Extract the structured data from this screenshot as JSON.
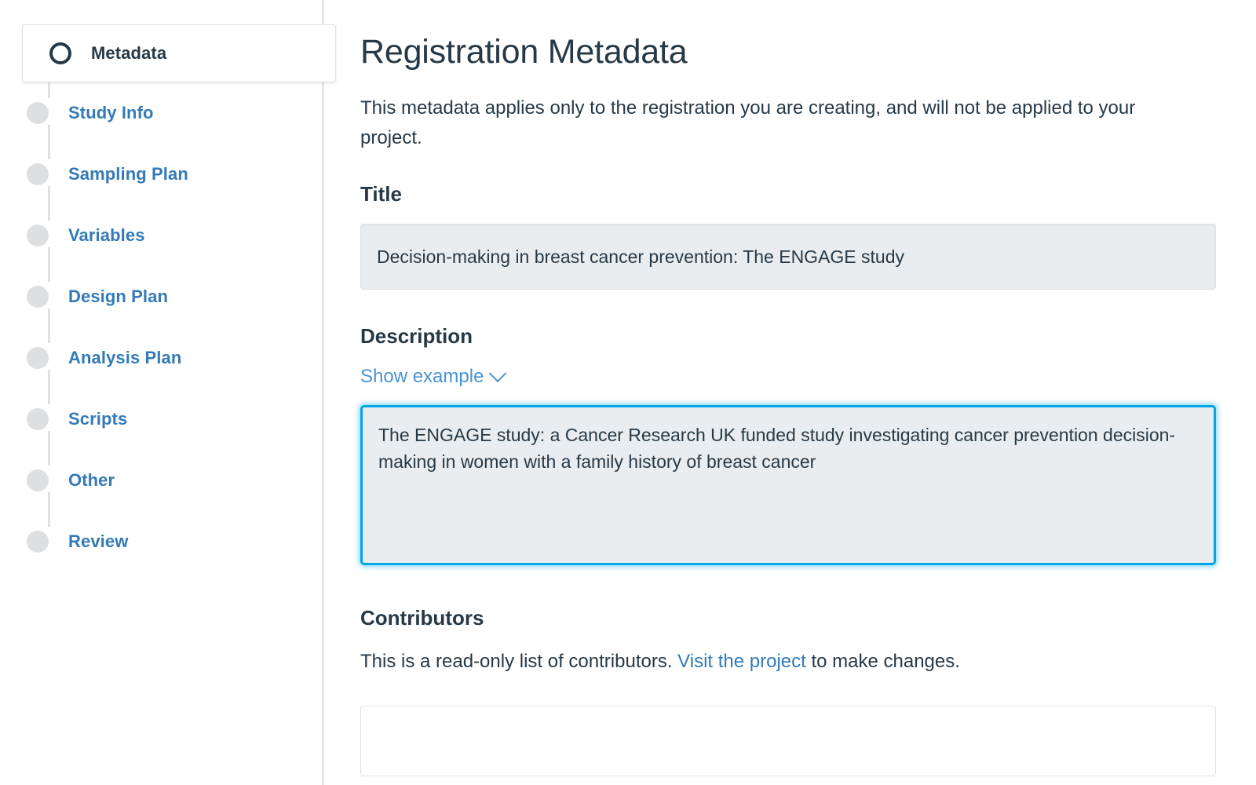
{
  "sidebar": {
    "steps": [
      {
        "label": "Metadata",
        "state": "active",
        "marker": "ring-icon"
      },
      {
        "label": "Study Info",
        "state": "pending",
        "marker": "dot-icon"
      },
      {
        "label": "Sampling Plan",
        "state": "pending",
        "marker": "dot-icon"
      },
      {
        "label": "Variables",
        "state": "pending",
        "marker": "dot-icon"
      },
      {
        "label": "Design Plan",
        "state": "pending",
        "marker": "dot-icon"
      },
      {
        "label": "Analysis Plan",
        "state": "pending",
        "marker": "dot-icon"
      },
      {
        "label": "Scripts",
        "state": "pending",
        "marker": "dot-icon"
      },
      {
        "label": "Other",
        "state": "pending",
        "marker": "dot-icon"
      },
      {
        "label": "Review",
        "state": "pending",
        "marker": "dot-icon"
      }
    ]
  },
  "main": {
    "title": "Registration Metadata",
    "intro": "This metadata applies only to the registration you are creating, and will not be applied to your project.",
    "title_field": {
      "heading": "Title",
      "value": "Decision-making in breast cancer prevention: The ENGAGE study",
      "placeholder": "Title"
    },
    "description_field": {
      "heading": "Description",
      "show_example_label": "Show example",
      "chevron": "chevron-down-icon",
      "value": "The ENGAGE study: a Cancer Research UK funded study investigating cancer prevention decision-making in women with a family history of breast cancer",
      "placeholder": "Description"
    },
    "contributors": {
      "heading": "Contributors",
      "note_before_link": "This is a read-only list of contributors. ",
      "link_text": "Visit the project",
      "note_after_link": " to make changes."
    }
  },
  "colors": {
    "link_blue": "#337ab7",
    "light_link_blue": "#4a94d2",
    "focus_blue": "#00a6e6",
    "text_dark": "#263947",
    "field_bg": "#e9edef",
    "dot_gray": "#dedfe1"
  }
}
